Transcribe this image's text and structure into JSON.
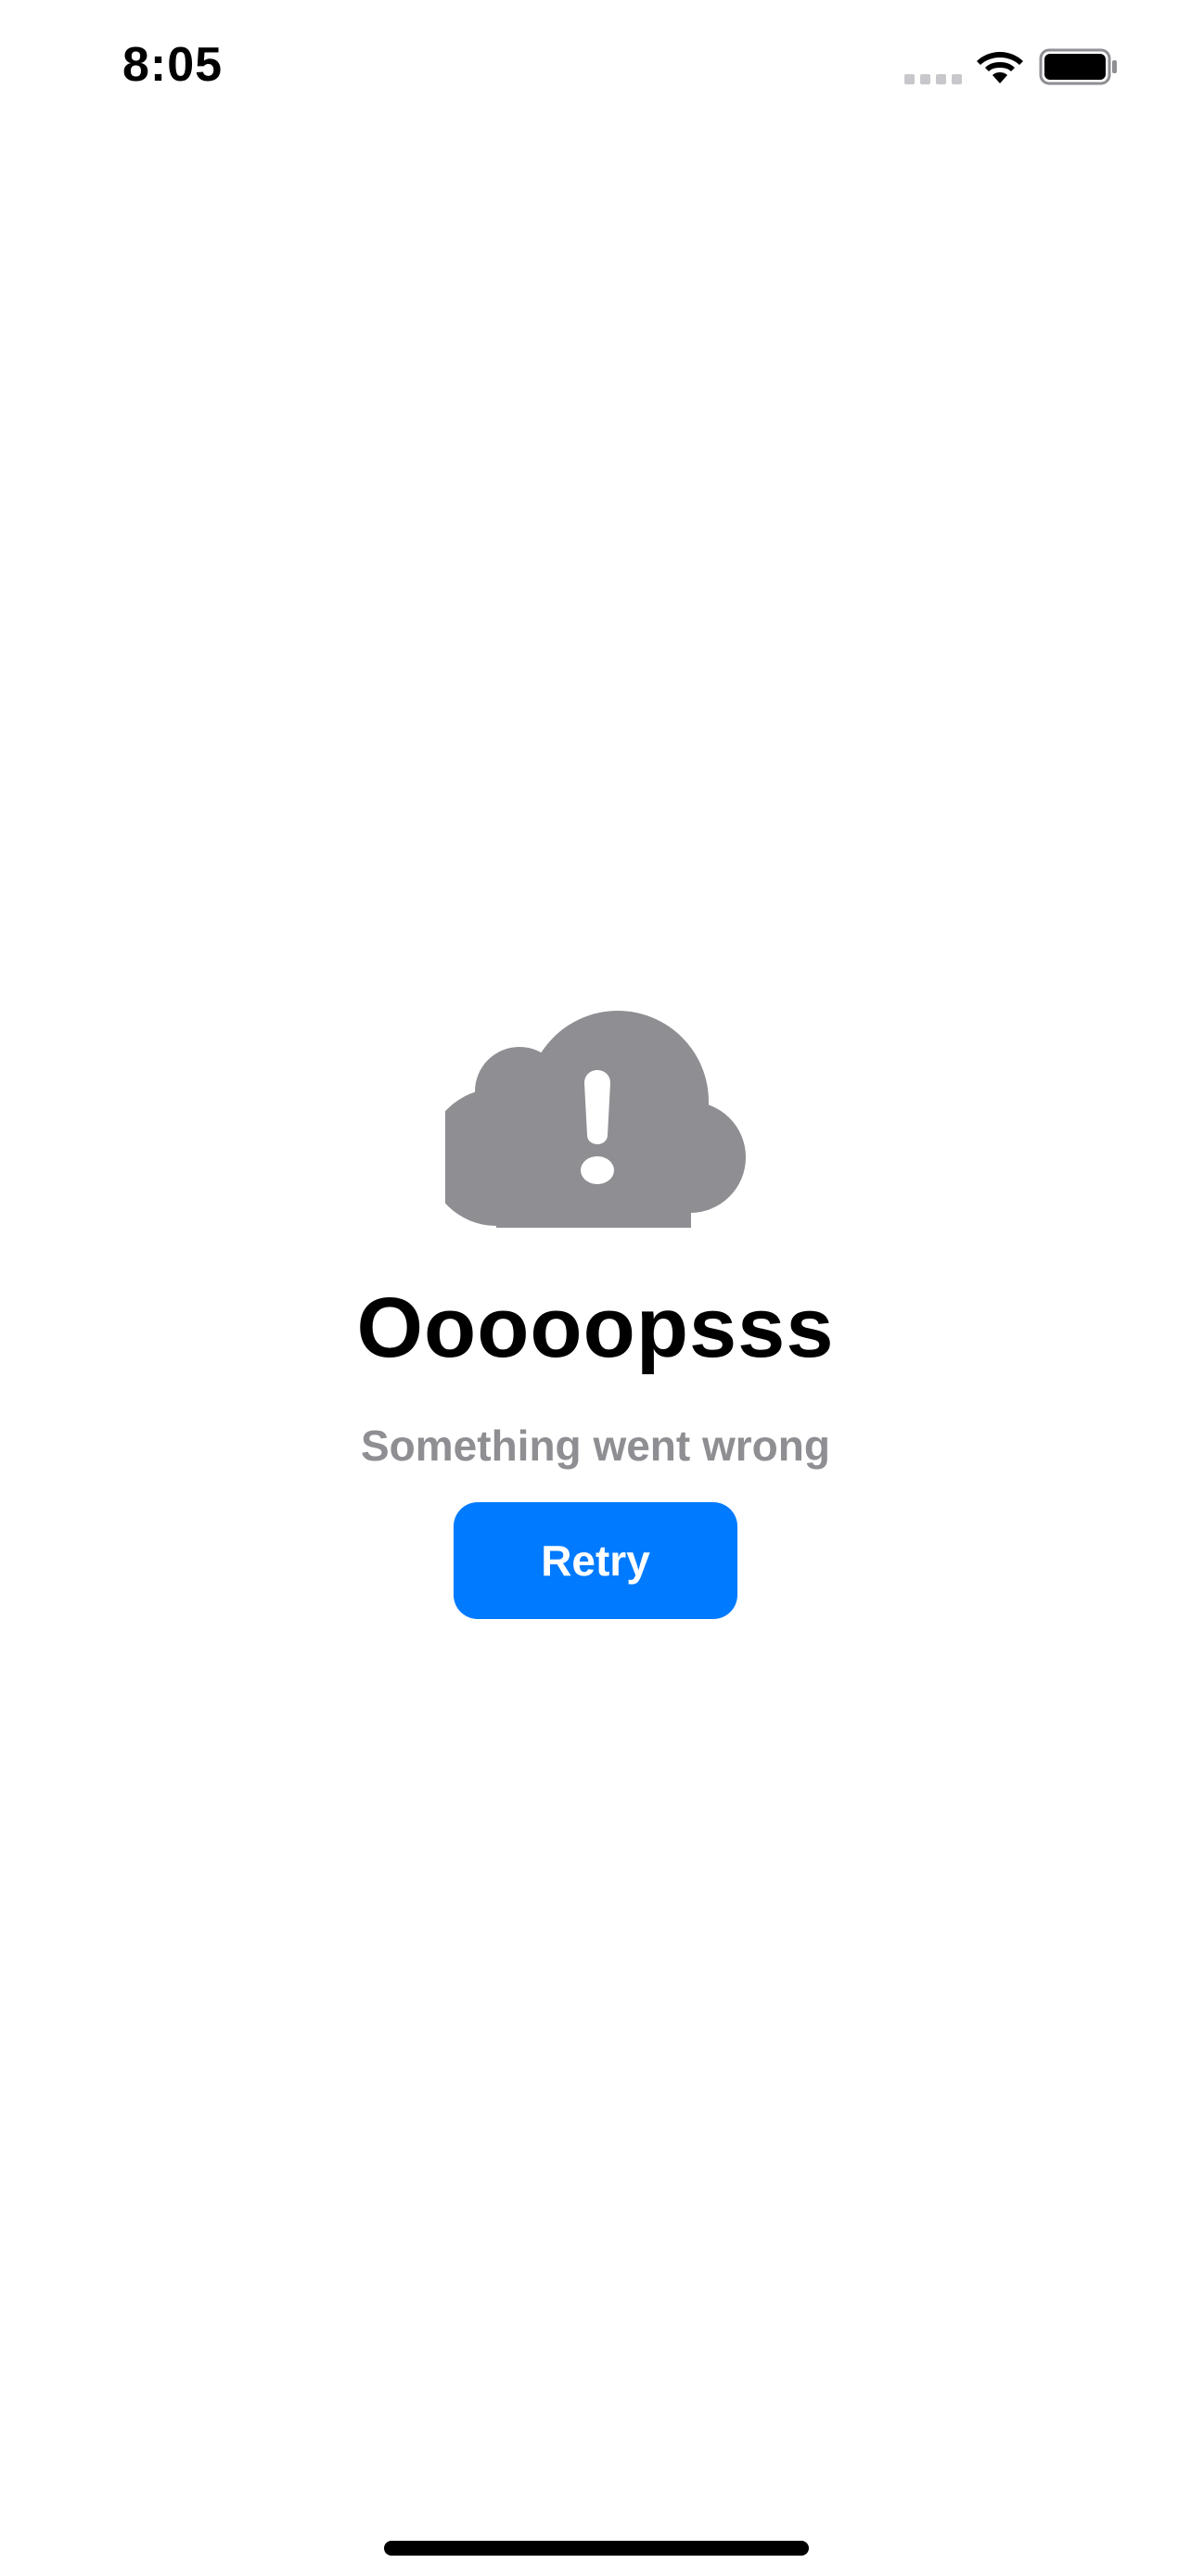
{
  "status_bar": {
    "time": "8:05"
  },
  "icons": {
    "error": "cloud-exclamation-icon",
    "wifi": "wifi-icon",
    "battery": "battery-icon",
    "signal": "cellular-signal-icon"
  },
  "error_screen": {
    "title": "Ooooopsss",
    "subtitle": "Something went wrong",
    "retry_label": "Retry"
  },
  "colors": {
    "accent": "#007aff",
    "icon_gray": "#8e8e93",
    "title": "#000000"
  }
}
